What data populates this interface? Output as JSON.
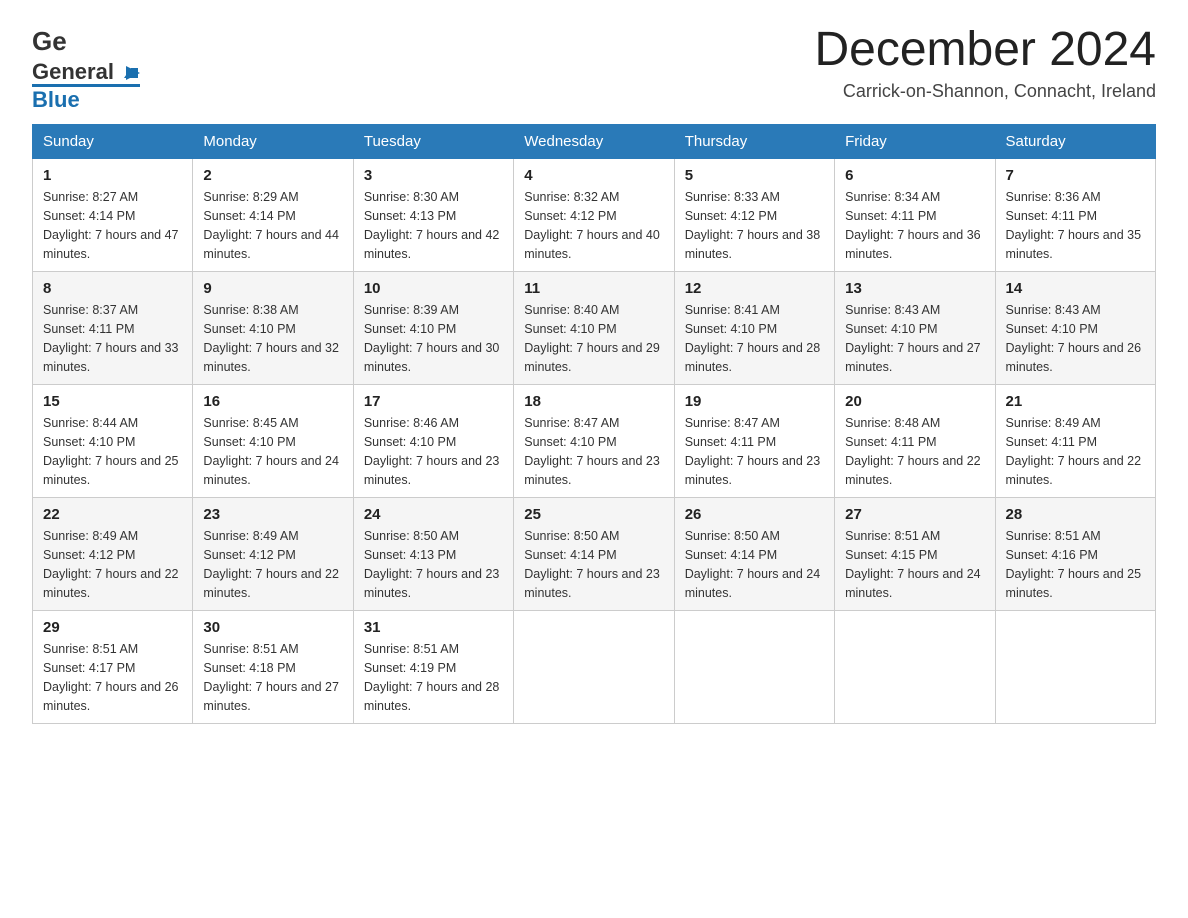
{
  "header": {
    "title": "December 2024",
    "location": "Carrick-on-Shannon, Connacht, Ireland"
  },
  "weekdays": [
    "Sunday",
    "Monday",
    "Tuesday",
    "Wednesday",
    "Thursday",
    "Friday",
    "Saturday"
  ],
  "weeks": [
    [
      {
        "day": "1",
        "sunrise": "8:27 AM",
        "sunset": "4:14 PM",
        "daylight": "7 hours and 47 minutes."
      },
      {
        "day": "2",
        "sunrise": "8:29 AM",
        "sunset": "4:14 PM",
        "daylight": "7 hours and 44 minutes."
      },
      {
        "day": "3",
        "sunrise": "8:30 AM",
        "sunset": "4:13 PM",
        "daylight": "7 hours and 42 minutes."
      },
      {
        "day": "4",
        "sunrise": "8:32 AM",
        "sunset": "4:12 PM",
        "daylight": "7 hours and 40 minutes."
      },
      {
        "day": "5",
        "sunrise": "8:33 AM",
        "sunset": "4:12 PM",
        "daylight": "7 hours and 38 minutes."
      },
      {
        "day": "6",
        "sunrise": "8:34 AM",
        "sunset": "4:11 PM",
        "daylight": "7 hours and 36 minutes."
      },
      {
        "day": "7",
        "sunrise": "8:36 AM",
        "sunset": "4:11 PM",
        "daylight": "7 hours and 35 minutes."
      }
    ],
    [
      {
        "day": "8",
        "sunrise": "8:37 AM",
        "sunset": "4:11 PM",
        "daylight": "7 hours and 33 minutes."
      },
      {
        "day": "9",
        "sunrise": "8:38 AM",
        "sunset": "4:10 PM",
        "daylight": "7 hours and 32 minutes."
      },
      {
        "day": "10",
        "sunrise": "8:39 AM",
        "sunset": "4:10 PM",
        "daylight": "7 hours and 30 minutes."
      },
      {
        "day": "11",
        "sunrise": "8:40 AM",
        "sunset": "4:10 PM",
        "daylight": "7 hours and 29 minutes."
      },
      {
        "day": "12",
        "sunrise": "8:41 AM",
        "sunset": "4:10 PM",
        "daylight": "7 hours and 28 minutes."
      },
      {
        "day": "13",
        "sunrise": "8:43 AM",
        "sunset": "4:10 PM",
        "daylight": "7 hours and 27 minutes."
      },
      {
        "day": "14",
        "sunrise": "8:43 AM",
        "sunset": "4:10 PM",
        "daylight": "7 hours and 26 minutes."
      }
    ],
    [
      {
        "day": "15",
        "sunrise": "8:44 AM",
        "sunset": "4:10 PM",
        "daylight": "7 hours and 25 minutes."
      },
      {
        "day": "16",
        "sunrise": "8:45 AM",
        "sunset": "4:10 PM",
        "daylight": "7 hours and 24 minutes."
      },
      {
        "day": "17",
        "sunrise": "8:46 AM",
        "sunset": "4:10 PM",
        "daylight": "7 hours and 23 minutes."
      },
      {
        "day": "18",
        "sunrise": "8:47 AM",
        "sunset": "4:10 PM",
        "daylight": "7 hours and 23 minutes."
      },
      {
        "day": "19",
        "sunrise": "8:47 AM",
        "sunset": "4:11 PM",
        "daylight": "7 hours and 23 minutes."
      },
      {
        "day": "20",
        "sunrise": "8:48 AM",
        "sunset": "4:11 PM",
        "daylight": "7 hours and 22 minutes."
      },
      {
        "day": "21",
        "sunrise": "8:49 AM",
        "sunset": "4:11 PM",
        "daylight": "7 hours and 22 minutes."
      }
    ],
    [
      {
        "day": "22",
        "sunrise": "8:49 AM",
        "sunset": "4:12 PM",
        "daylight": "7 hours and 22 minutes."
      },
      {
        "day": "23",
        "sunrise": "8:49 AM",
        "sunset": "4:12 PM",
        "daylight": "7 hours and 22 minutes."
      },
      {
        "day": "24",
        "sunrise": "8:50 AM",
        "sunset": "4:13 PM",
        "daylight": "7 hours and 23 minutes."
      },
      {
        "day": "25",
        "sunrise": "8:50 AM",
        "sunset": "4:14 PM",
        "daylight": "7 hours and 23 minutes."
      },
      {
        "day": "26",
        "sunrise": "8:50 AM",
        "sunset": "4:14 PM",
        "daylight": "7 hours and 24 minutes."
      },
      {
        "day": "27",
        "sunrise": "8:51 AM",
        "sunset": "4:15 PM",
        "daylight": "7 hours and 24 minutes."
      },
      {
        "day": "28",
        "sunrise": "8:51 AM",
        "sunset": "4:16 PM",
        "daylight": "7 hours and 25 minutes."
      }
    ],
    [
      {
        "day": "29",
        "sunrise": "8:51 AM",
        "sunset": "4:17 PM",
        "daylight": "7 hours and 26 minutes."
      },
      {
        "day": "30",
        "sunrise": "8:51 AM",
        "sunset": "4:18 PM",
        "daylight": "7 hours and 27 minutes."
      },
      {
        "day": "31",
        "sunrise": "8:51 AM",
        "sunset": "4:19 PM",
        "daylight": "7 hours and 28 minutes."
      },
      null,
      null,
      null,
      null
    ]
  ]
}
